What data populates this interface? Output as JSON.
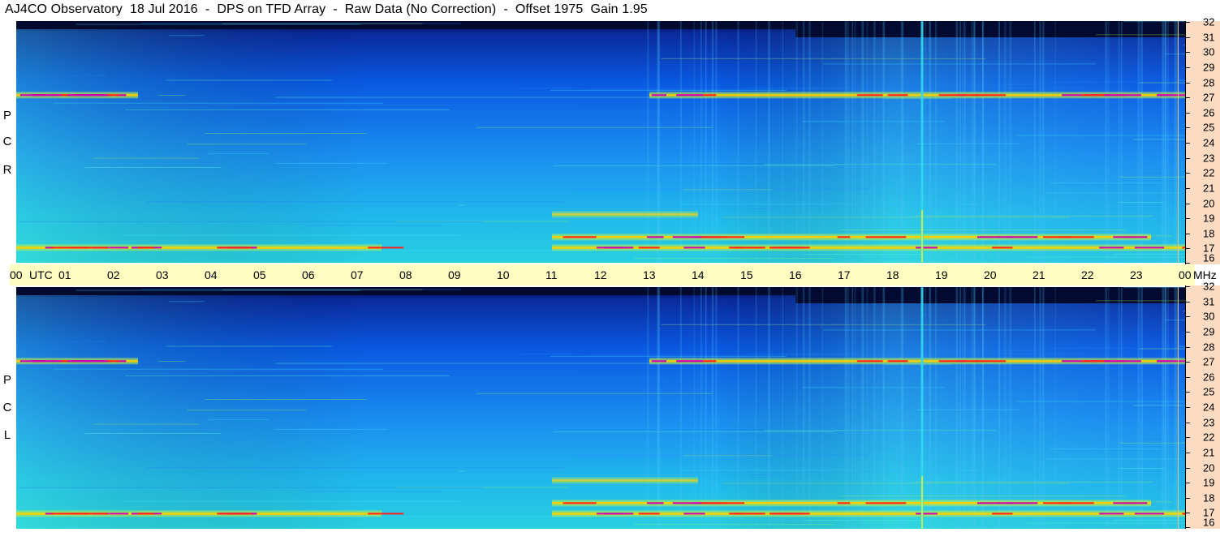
{
  "title": "AJ4CO Observatory  18 Jul 2016  -  DPS on TFD Array  -  Raw Data (No Correction)  -  Offset 1975  Gain 1.95",
  "panels": [
    {
      "id": "rcp",
      "label": [
        "R",
        "C",
        "P"
      ]
    },
    {
      "id": "lcp",
      "label": [
        "L",
        "C",
        "P"
      ]
    }
  ],
  "time_axis": {
    "labels": [
      "00",
      "01",
      "02",
      "03",
      "04",
      "05",
      "06",
      "07",
      "08",
      "09",
      "10",
      "11",
      "12",
      "13",
      "14",
      "15",
      "16",
      "17",
      "18",
      "19",
      "20",
      "21",
      "22",
      "23",
      "00"
    ],
    "unit": "UTC",
    "freq_unit": "MHz"
  },
  "freq_axis": {
    "labels": [
      "32",
      "31",
      "30",
      "29",
      "28",
      "27",
      "26",
      "25",
      "24",
      "23",
      "22",
      "21",
      "20",
      "19",
      "18",
      "17",
      "16"
    ]
  },
  "chart_data": {
    "type": "heatmap",
    "title": "AJ4CO Observatory  18 Jul 2016  -  DPS on TFD Array  -  Raw Data (No Correction)  -  Offset 1975  Gain 1.95",
    "xlabel": "UTC",
    "ylabel": "MHz",
    "xlim": [
      0,
      24
    ],
    "ylim": [
      16,
      32
    ],
    "panels": [
      "RCP",
      "LCP"
    ],
    "colormap": [
      "#001060",
      "#0a3fd8",
      "#1aa0f0",
      "#30e0d0",
      "#c8f040",
      "#ffd000",
      "#ff2020",
      "#c000c0",
      "#ffffff"
    ],
    "features": [
      {
        "freq_mhz": 27.1,
        "utc_range": [
          0,
          2.5
        ],
        "intensity": "high"
      },
      {
        "freq_mhz": 27.1,
        "utc_range": [
          13,
          24
        ],
        "intensity": "high"
      },
      {
        "freq_mhz": 17.7,
        "utc_range": [
          11,
          23.3
        ],
        "intensity": "high"
      },
      {
        "freq_mhz": 17.0,
        "utc_range": [
          0,
          7.5
        ],
        "intensity": "high"
      },
      {
        "freq_mhz": 17.0,
        "utc_range": [
          11,
          24
        ],
        "intensity": "high"
      },
      {
        "freq_mhz": 19.2,
        "utc_range": [
          11,
          14
        ],
        "intensity": "medium"
      },
      {
        "broadband_utc": 18.6,
        "intensity": "high"
      }
    ]
  }
}
